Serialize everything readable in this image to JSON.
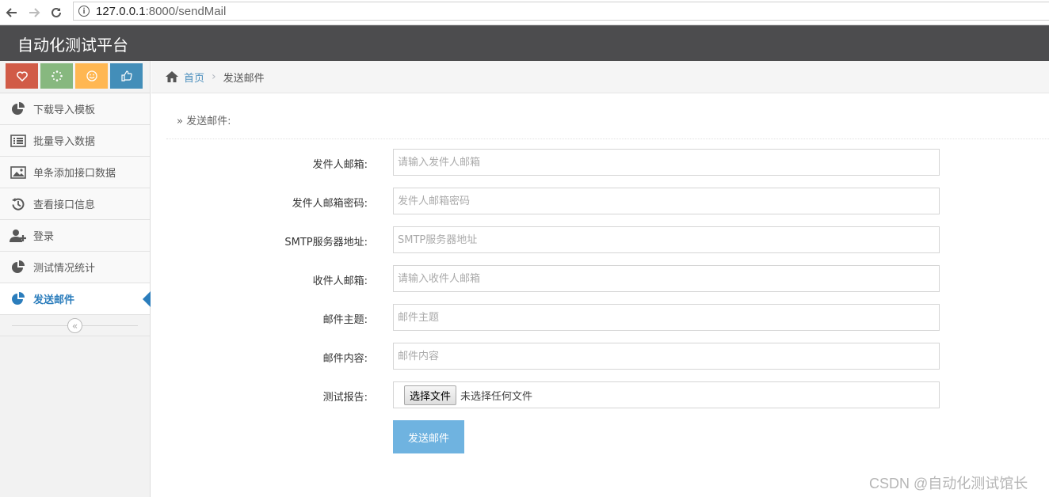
{
  "browser": {
    "url_host": "127.0.0.1",
    "url_path": ":8000/sendMail"
  },
  "app": {
    "title": "自动化测试平台"
  },
  "sidebar": {
    "shortcuts": [
      {
        "icon": "heart-icon",
        "color": "#d15b47"
      },
      {
        "icon": "spinner-icon",
        "color": "#87b87f"
      },
      {
        "icon": "smile-icon",
        "color": "#ffb752"
      },
      {
        "icon": "thumbs-up-icon",
        "color": "#438eb9"
      }
    ],
    "items": [
      {
        "label": "下载导入模板",
        "icon": "pie-chart-icon"
      },
      {
        "label": "批量导入数据",
        "icon": "list-icon"
      },
      {
        "label": "单条添加接口数据",
        "icon": "picture-icon"
      },
      {
        "label": "查看接口信息",
        "icon": "history-icon"
      },
      {
        "label": "登录",
        "icon": "user-plus-icon"
      },
      {
        "label": "测试情况统计",
        "icon": "pie-chart-icon"
      },
      {
        "label": "发送邮件",
        "icon": "pie-chart-icon",
        "active": true
      }
    ],
    "collapse_glyph": "«"
  },
  "breadcrumb": {
    "home": "首页",
    "separator": "›",
    "current": "发送邮件"
  },
  "section": {
    "title": "» 发送邮件:"
  },
  "form": {
    "fields": [
      {
        "label": "发件人邮箱:",
        "placeholder": "请输入发件人邮箱"
      },
      {
        "label": "发件人邮箱密码:",
        "placeholder": "发件人邮箱密码"
      },
      {
        "label": "SMTP服务器地址:",
        "placeholder": "SMTP服务器地址"
      },
      {
        "label": "收件人邮箱:",
        "placeholder": "请输入收件人邮箱"
      },
      {
        "label": "邮件主题:",
        "placeholder": "邮件主题"
      },
      {
        "label": "邮件内容:",
        "placeholder": "邮件内容"
      }
    ],
    "report": {
      "label": "测试报告:",
      "button": "选择文件",
      "status": "未选择任何文件"
    },
    "submit": "发送邮件"
  },
  "watermark": "CSDN @自动化测试馆长",
  "colors": {
    "header_bg": "#4c4c4e",
    "active_accent": "#2b7dbc",
    "submit_bg": "#6fb3e0"
  }
}
